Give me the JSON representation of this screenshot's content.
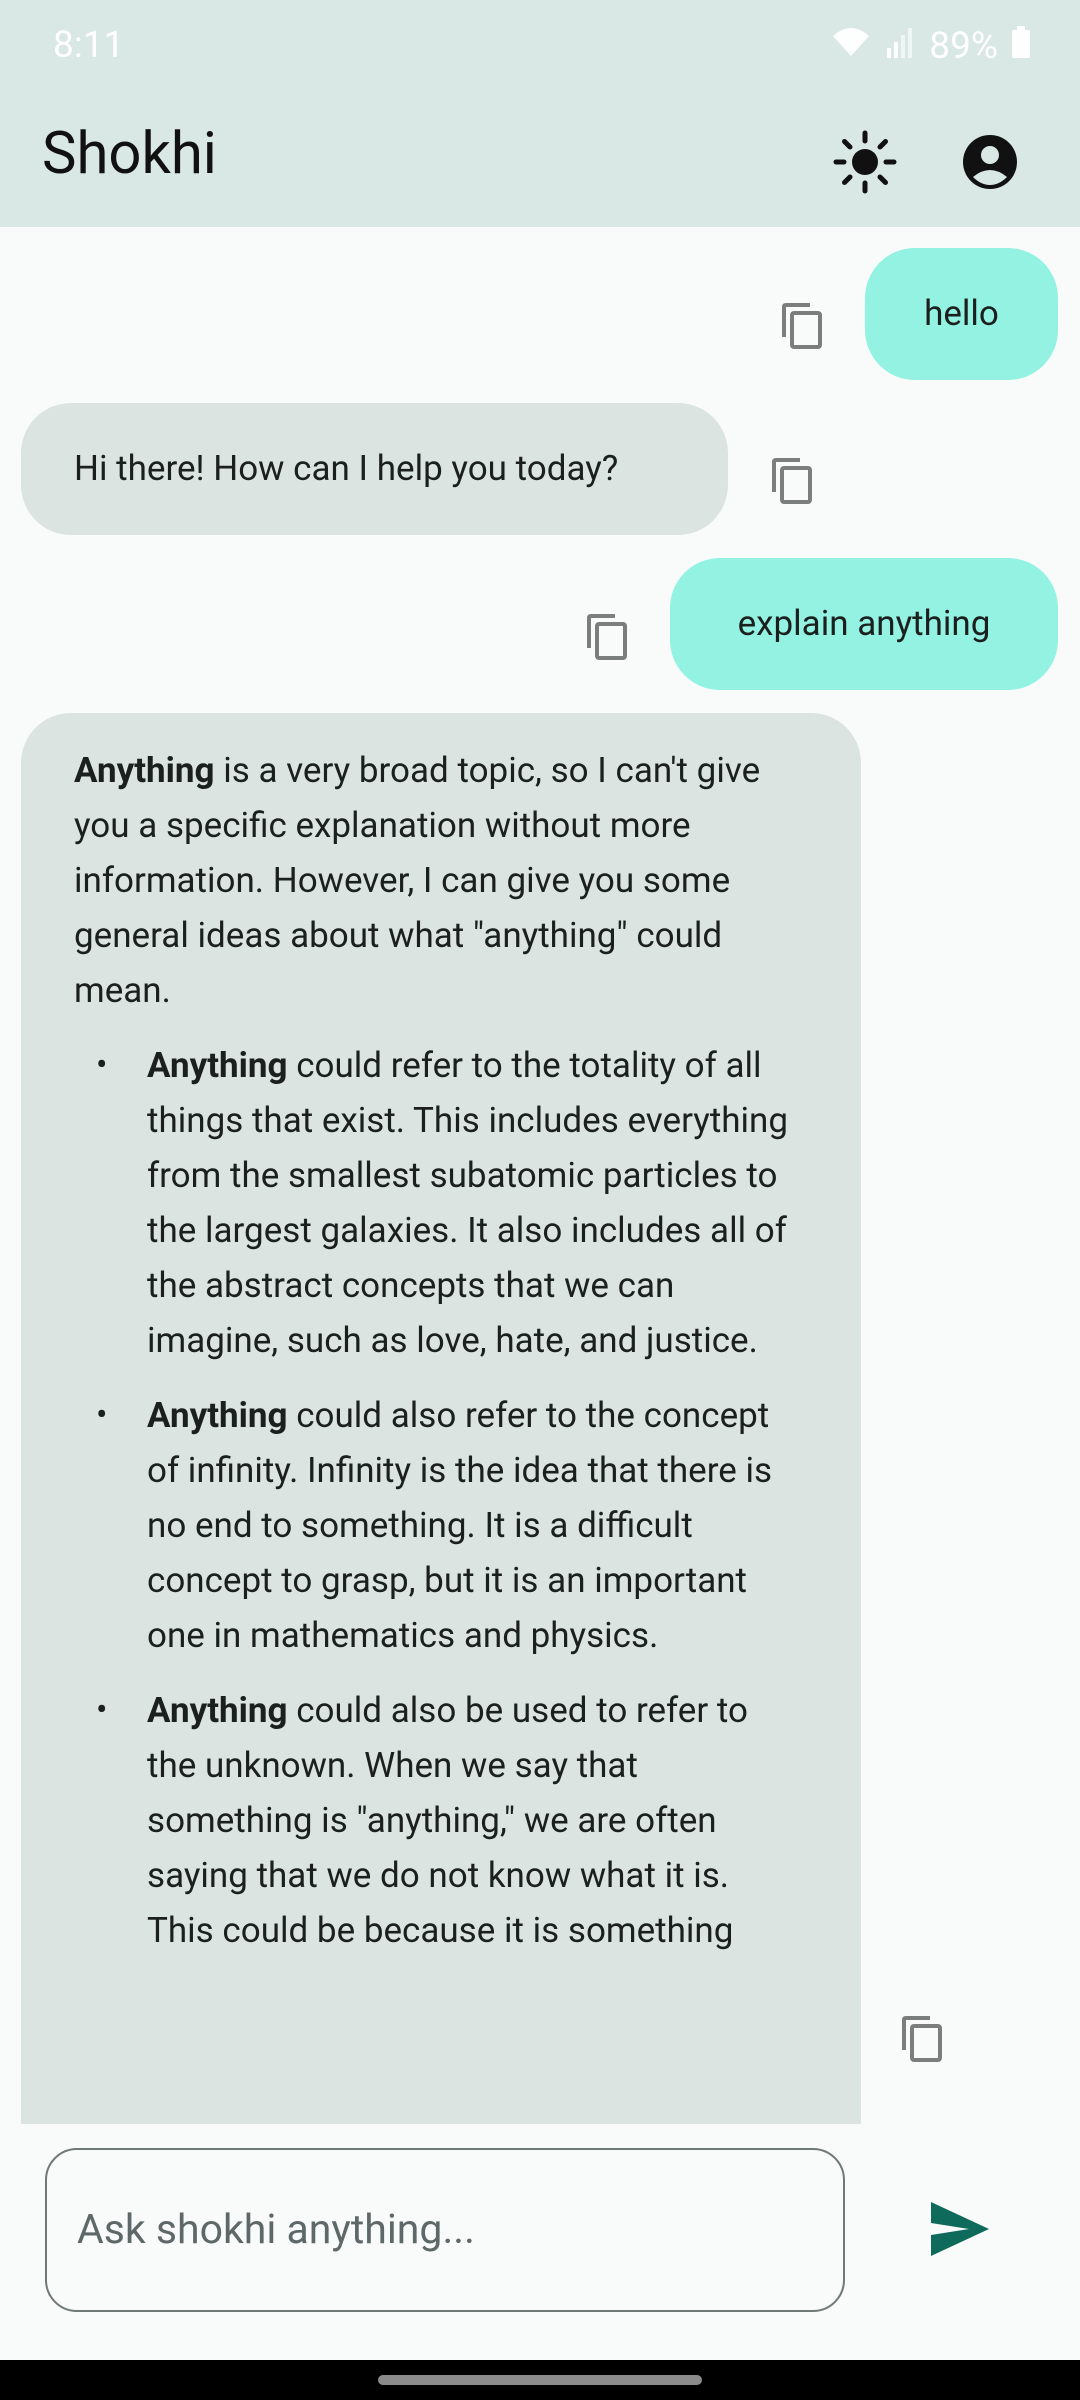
{
  "status": {
    "time": "8:11",
    "battery": "89%"
  },
  "app": {
    "title": "Shokhi",
    "theme_icon": "sun-icon",
    "account_icon": "account-circle-icon"
  },
  "messages": [
    {
      "role": "user",
      "text": "hello"
    },
    {
      "role": "bot",
      "text": "Hi there! How can I help you today?"
    },
    {
      "role": "user",
      "text": "explain anything"
    },
    {
      "role": "bot",
      "intro_bold": "Anything",
      "intro_rest": " is a very broad topic, so I can't give you a specific explanation without more information. However, I can give you some general ideas about what \"anything\" could mean.",
      "bullets": [
        {
          "bold": "Anything",
          "text": " could refer to the totality of all things that exist. This includes everything from the smallest subatomic particles to the largest galaxies. It also includes all of the abstract concepts that we can imagine, such as love, hate, and justice."
        },
        {
          "bold": "Anything",
          "text": " could also refer to the concept of infinity. Infinity is the idea that there is no end to something. It is a difficult concept to grasp, but it is an important one in mathematics and physics."
        },
        {
          "bold": "Anything",
          "text": " could also be used to refer to the unknown. When we say that something is \"anything,\" we are often saying that we do not know what it is. This could be because it is something"
        }
      ]
    }
  ],
  "composer": {
    "placeholder": "Ask shokhi anything...",
    "send_icon": "send-icon"
  },
  "colors": {
    "appbar": "#d9e7e5",
    "user_bubble": "#93f2e2",
    "bot_bubble": "#dbe4e1",
    "send": "#0e6b5c"
  }
}
